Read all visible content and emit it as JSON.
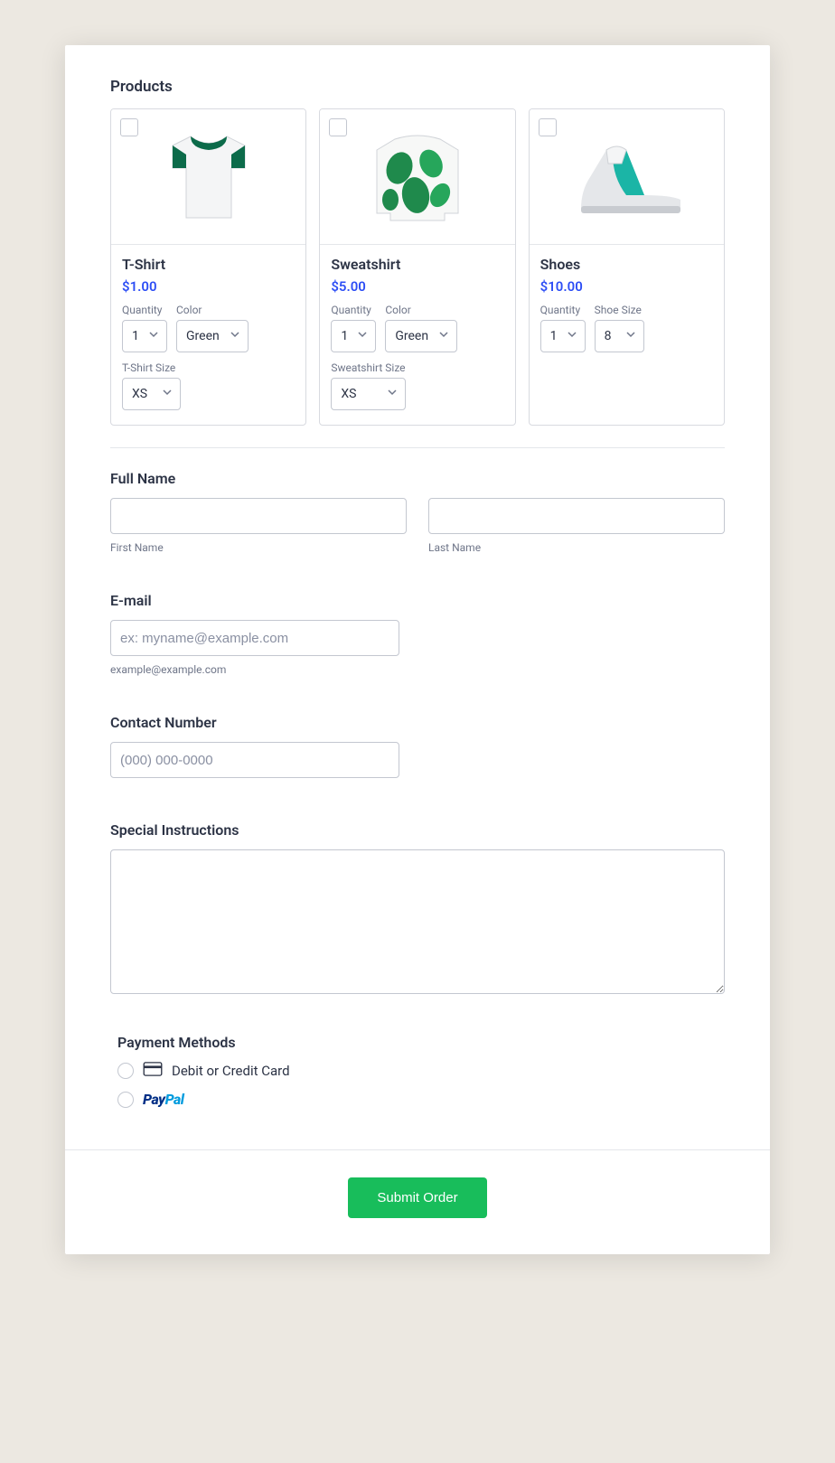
{
  "products_heading": "Products",
  "products": [
    {
      "name": "T-Shirt",
      "price": "$1.00",
      "qty_label": "Quantity",
      "qty_value": "1",
      "color_label": "Color",
      "color_value": "Green",
      "size_label": "T-Shirt Size",
      "size_value": "XS"
    },
    {
      "name": "Sweatshirt",
      "price": "$5.00",
      "qty_label": "Quantity",
      "qty_value": "1",
      "color_label": "Color",
      "color_value": "Green",
      "size_label": "Sweatshirt Size",
      "size_value": "XS"
    },
    {
      "name": "Shoes",
      "price": "$10.00",
      "qty_label": "Quantity",
      "qty_value": "1",
      "shoe_label": "Shoe Size",
      "shoe_value": "8"
    }
  ],
  "full_name": {
    "label": "Full Name",
    "first_sub": "First Name",
    "last_sub": "Last Name"
  },
  "email": {
    "label": "E-mail",
    "placeholder": "ex: myname@example.com",
    "sub": "example@example.com"
  },
  "contact": {
    "label": "Contact Number",
    "placeholder": "(000) 000-0000"
  },
  "instructions": {
    "label": "Special Instructions"
  },
  "payment": {
    "label": "Payment Methods",
    "card_label": "Debit or Credit Card"
  },
  "submit_label": "Submit Order"
}
